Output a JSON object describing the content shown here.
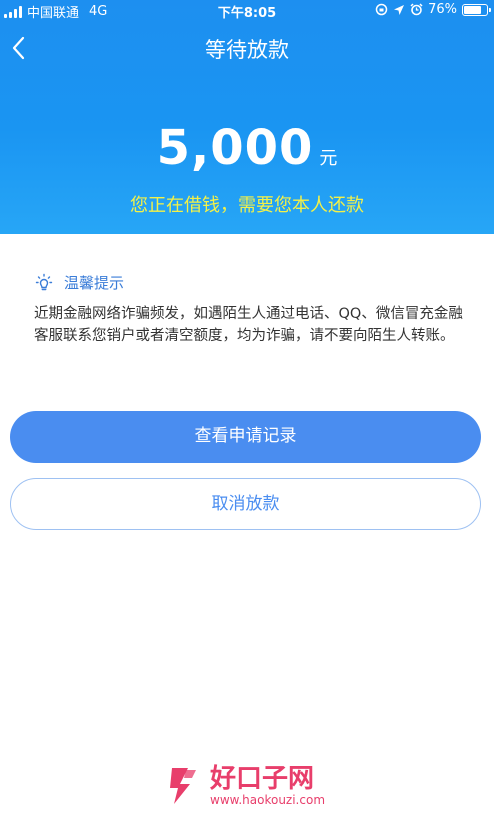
{
  "status_bar": {
    "carrier": "中国联通",
    "network": "4G",
    "time": "下午8:05",
    "battery": "76%",
    "battery_level": 0.76
  },
  "header": {
    "back_icon": "chevron-left-icon",
    "title": "等待放款"
  },
  "loan": {
    "amount": "5,000",
    "unit": "元",
    "note": "您正在借钱，需要您本人还款"
  },
  "tips": {
    "icon": "lightbulb-icon",
    "title": "温馨提示",
    "body": "近期金融网络诈骗频发，如遇陌生人通过电话、QQ、微信冒充金融客服联系您销户或者清空额度，均为诈骗，请不要向陌生人转账。"
  },
  "actions": {
    "view_records": "查看申请记录",
    "cancel_loan": "取消放款"
  },
  "watermark": {
    "name": "好口子网",
    "url": "www.haokouzi.com"
  },
  "colors": {
    "header_blue": "#1d8ff0",
    "note_yellow": "#f3f148",
    "button_blue": "#4a8df0",
    "tip_title_blue": "#3b7dd8",
    "watermark_pink": "#e83e6b"
  }
}
